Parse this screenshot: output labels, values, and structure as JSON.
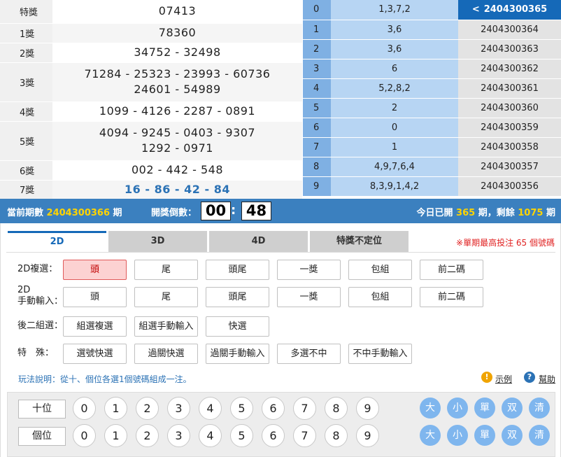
{
  "prizes": [
    {
      "name": "特獎",
      "lines": [
        "07413"
      ]
    },
    {
      "name": "1獎",
      "lines": [
        "78360"
      ]
    },
    {
      "name": "2獎",
      "lines": [
        "34752 - 32498"
      ]
    },
    {
      "name": "3獎",
      "lines": [
        "71284 - 25323 - 23993 - 60736",
        "24601 - 54989"
      ]
    },
    {
      "name": "4獎",
      "lines": [
        "1099 - 4126 - 2287 - 0891"
      ]
    },
    {
      "name": "5獎",
      "lines": [
        "4094 - 9245 - 0403 - 9307",
        "1292 - 0971"
      ]
    },
    {
      "name": "6獎",
      "lines": [
        "002 - 442 - 548"
      ]
    },
    {
      "name": "7獎",
      "lines": [
        "16 - 86 - 42 - 84"
      ]
    }
  ],
  "tails": [
    {
      "idx": "0",
      "val": "1,3,7,2",
      "period": "2404300365"
    },
    {
      "idx": "1",
      "val": "3,6",
      "period": "2404300364"
    },
    {
      "idx": "2",
      "val": "3,6",
      "period": "2404300363"
    },
    {
      "idx": "3",
      "val": "6",
      "period": "2404300362"
    },
    {
      "idx": "4",
      "val": "5,2,8,2",
      "period": "2404300361"
    },
    {
      "idx": "5",
      "val": "2",
      "period": "2404300360"
    },
    {
      "idx": "6",
      "val": "0",
      "period": "2404300359"
    },
    {
      "idx": "7",
      "val": "1",
      "period": "2404300358"
    },
    {
      "idx": "8",
      "val": "4,9,7,6,4",
      "period": "2404300357"
    },
    {
      "idx": "9",
      "val": "8,3,9,1,4,2",
      "period": "2404300356"
    }
  ],
  "nav_arrow": "<",
  "status": {
    "current_label": "當前期數",
    "current_period": "2404300366",
    "period_unit": "期",
    "countdown_label": "開獎倒數：",
    "min": "00",
    "colon": ":",
    "sec": "48",
    "today_label": "今日已開",
    "opened": "365",
    "opened_unit": "期，剩餘",
    "remaining": "1075",
    "remaining_unit": "期"
  },
  "tabs": [
    "2D",
    "3D",
    "4D",
    "特獎不定位"
  ],
  "limit_note": "※單期最高投注 65 個號碼",
  "rows": [
    {
      "label": "2D複選：",
      "options": [
        "頭",
        "尾",
        "頭尾",
        "一獎",
        "包組",
        "前二碼"
      ]
    },
    {
      "label": "2D\n手動輸入：",
      "options": [
        "頭",
        "尾",
        "頭尾",
        "一獎",
        "包組",
        "前二碼"
      ]
    },
    {
      "label": "後二組選：",
      "options": [
        "組選複選",
        "組選手動輸入",
        "快選"
      ]
    },
    {
      "label": "特　殊：",
      "options": [
        "選號快選",
        "過關快選",
        "過關手動輸入",
        "多選不中",
        "不中手動輸入"
      ]
    }
  ],
  "rule_text": "玩法說明：從十、個位各選1個號碼組成一注。",
  "example_link": "示例",
  "help_link": "幫助",
  "info_glyph": "!",
  "help_glyph": "?",
  "positions": [
    "十位",
    "個位"
  ],
  "balls": [
    "0",
    "1",
    "2",
    "3",
    "4",
    "5",
    "6",
    "7",
    "8",
    "9"
  ],
  "quick": [
    "大",
    "小",
    "單",
    "双",
    "清"
  ],
  "colors": {
    "accent": "#1569b8",
    "status_bar": "#3b80bf",
    "highlight": "#ffd400",
    "selected_bg": "#fcd2d2",
    "quick_btn": "#7fb6ee"
  }
}
